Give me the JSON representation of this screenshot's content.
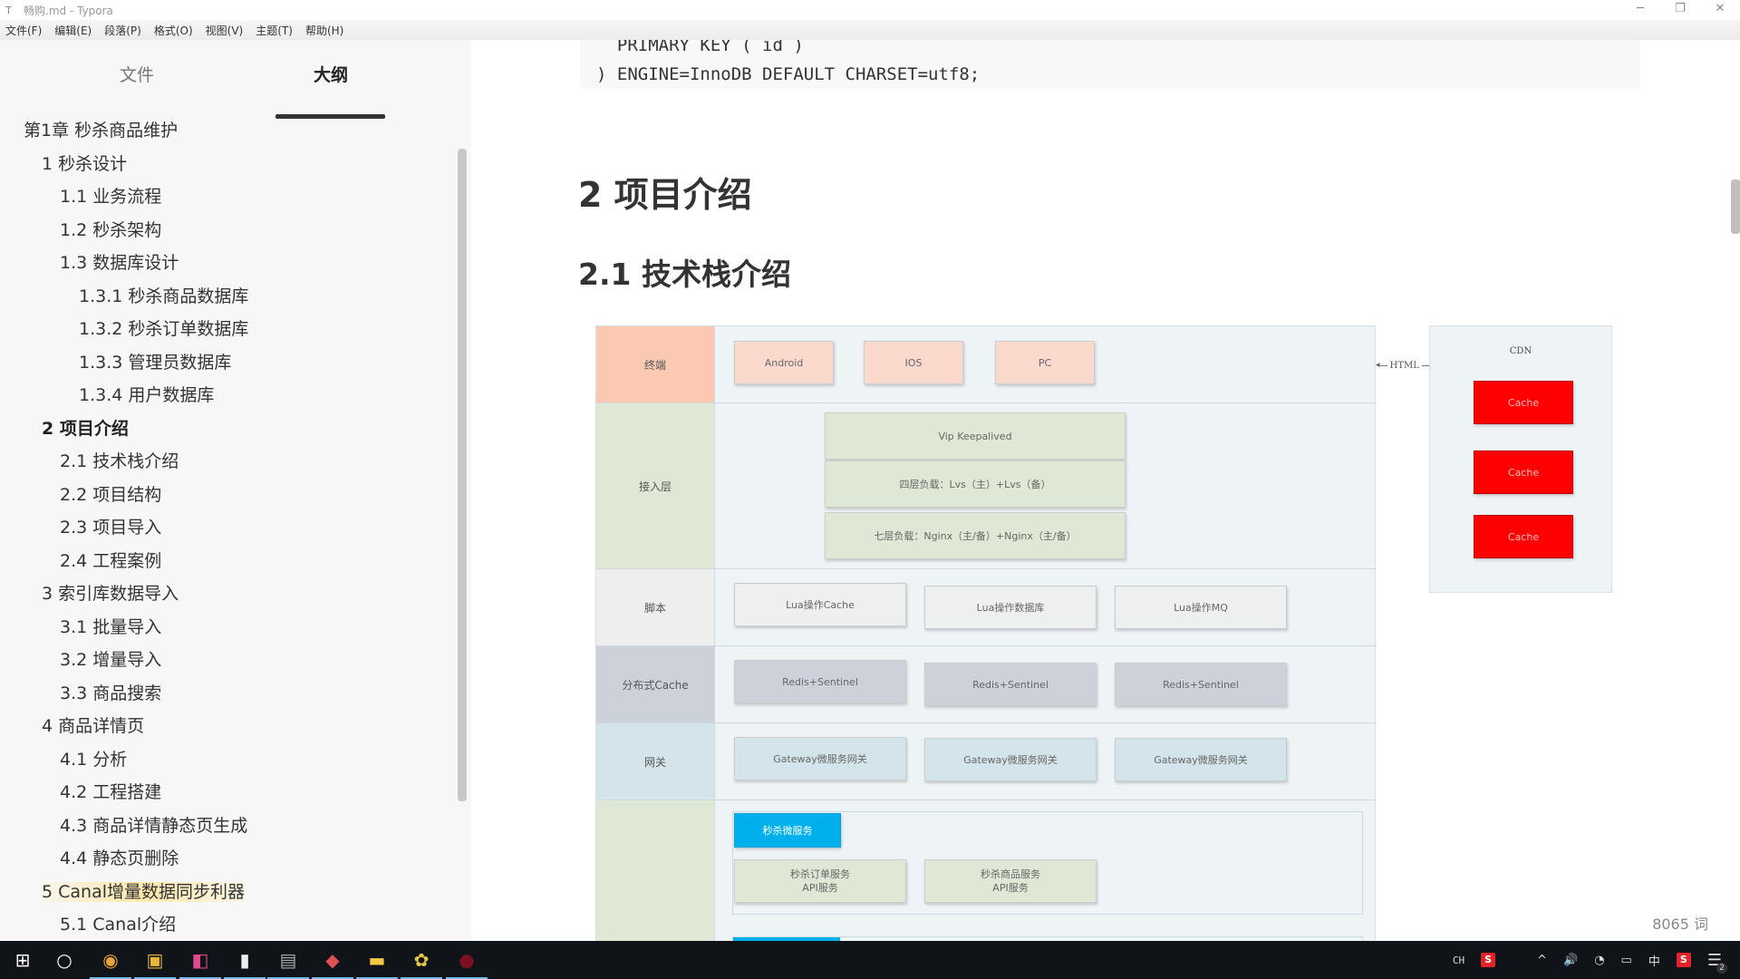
{
  "window": {
    "title": "畅购.md - Typora",
    "controls": {
      "minimize": "─",
      "restore": "❐",
      "close": "✕"
    }
  },
  "menu": [
    "文件(F)",
    "编辑(E)",
    "段落(P)",
    "格式(O)",
    "视图(V)",
    "主题(T)",
    "帮助(H)"
  ],
  "sidebar": {
    "tabs": {
      "files": "文件",
      "outline": "大纲"
    },
    "active_tab": "outline",
    "outline": [
      {
        "label": "第1章 秒杀商品维护",
        "level": 0
      },
      {
        "label": "1 秒杀设计",
        "level": 1
      },
      {
        "label": "1.1 业务流程",
        "level": 2
      },
      {
        "label": "1.2 秒杀架构",
        "level": 2
      },
      {
        "label": "1.3 数据库设计",
        "level": 2
      },
      {
        "label": "1.3.1 秒杀商品数据库",
        "level": 3
      },
      {
        "label": "1.3.2 秒杀订单数据库",
        "level": 3
      },
      {
        "label": "1.3.3 管理员数据库",
        "level": 3
      },
      {
        "label": "1.3.4 用户数据库",
        "level": 3
      },
      {
        "label": "2 项目介绍",
        "level": 1,
        "active": true
      },
      {
        "label": "2.1 技术栈介绍",
        "level": 2
      },
      {
        "label": "2.2 项目结构",
        "level": 2
      },
      {
        "label": "2.3 项目导入",
        "level": 2
      },
      {
        "label": "2.4 工程案例",
        "level": 2
      },
      {
        "label": "3 索引库数据导入",
        "level": 1
      },
      {
        "label": "3.1 批量导入",
        "level": 2
      },
      {
        "label": "3.2 增量导入",
        "level": 2
      },
      {
        "label": "3.3 商品搜索",
        "level": 2
      },
      {
        "label": "4 商品详情页",
        "level": 1
      },
      {
        "label": "4.1 分析",
        "level": 2
      },
      {
        "label": "4.2 工程搭建",
        "level": 2
      },
      {
        "label": "4.3 商品详情静态页生成",
        "level": 2
      },
      {
        "label": "4.4 静态页删除",
        "level": 2
      },
      {
        "label": "5 Canal增量数据同步利器",
        "level": 1,
        "highlight": true
      },
      {
        "label": "5.1 Canal介绍",
        "level": 2
      }
    ],
    "footer": {
      "back_icon": "‹",
      "source_icon": "</>"
    }
  },
  "editor": {
    "code_lines": [
      "  PRIMARY KEY ( id )",
      ") ENGINE=InnoDB DEFAULT CHARSET=utf8;"
    ],
    "h1": "2 项目介绍",
    "h2": "2.1 技术栈介绍",
    "word_count": "8065 词"
  },
  "diagram": {
    "rows": [
      {
        "label": "终端",
        "boxes": [
          "Android",
          "IOS",
          "PC"
        ]
      },
      {
        "label": "接入层",
        "boxes": [
          "Vip  Keepalived",
          "四层负载：Lvs（主）+Lvs（备）",
          "七层负载：Nginx（主/备）+Nginx（主/备）"
        ]
      },
      {
        "label": "脚本",
        "boxes": [
          "Lua操作Cache",
          "Lua操作数据库",
          "Lua操作MQ"
        ]
      },
      {
        "label": "分布式Cache",
        "boxes": [
          "Redis+Sentinel",
          "Redis+Sentinel",
          "Redis+Sentinel"
        ]
      },
      {
        "label": "网关",
        "boxes": [
          "Gateway微服务网关",
          "Gateway微服务网关",
          "Gateway微服务网关"
        ]
      },
      {
        "label": "",
        "group_title": "秒杀微服务",
        "boxes": [
          "秒杀订单服务\nAPI服务",
          "秒杀商品服务\nAPI服务"
        ]
      }
    ],
    "arrow_label": "HTML",
    "cdn": {
      "title": "CDN",
      "boxes": [
        "Cache",
        "Cache",
        "Cache"
      ]
    }
  },
  "taskbar": {
    "apps": [
      "start",
      "cortana",
      "chrome",
      "toolbox",
      "intellij",
      "typora",
      "terminal",
      "git",
      "explorer",
      "wechat-devtool",
      "recorder"
    ],
    "tray": {
      "lang": "CH",
      "ime": "中",
      "notifications": "2"
    }
  }
}
